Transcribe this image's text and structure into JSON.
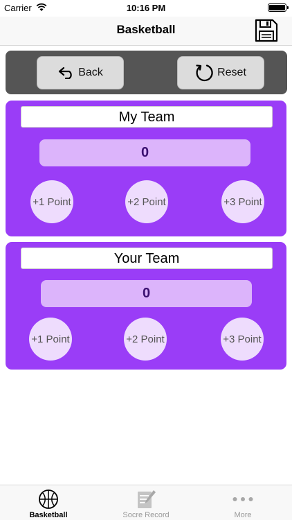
{
  "status_bar": {
    "carrier": "Carrier",
    "time": "10:16 PM"
  },
  "nav": {
    "title": "Basketball",
    "save_icon": "floppy-disk-icon"
  },
  "toolbar": {
    "back_label": "Back",
    "back_icon": "undo-arrow-icon",
    "reset_label": "Reset",
    "reset_icon": "reload-icon"
  },
  "teams": [
    {
      "name": "My Team",
      "score": "0",
      "buttons": [
        "+1 Point",
        "+2 Point",
        "+3 Point"
      ]
    },
    {
      "name": "Your Team",
      "score": "0",
      "buttons": [
        "+1 Point",
        "+2 Point",
        "+3 Point"
      ]
    }
  ],
  "colors": {
    "card": "#9a3df7",
    "score_box": "#dcb4fb",
    "point_button": "#eedcfd",
    "toolbar": "#555555"
  },
  "tabs": [
    {
      "label": "Basketball",
      "icon": "basketball-icon",
      "active": true
    },
    {
      "label": "Socre Record",
      "icon": "notepad-icon",
      "active": false
    },
    {
      "label": "More",
      "icon": "more-dots-icon",
      "active": false
    }
  ]
}
